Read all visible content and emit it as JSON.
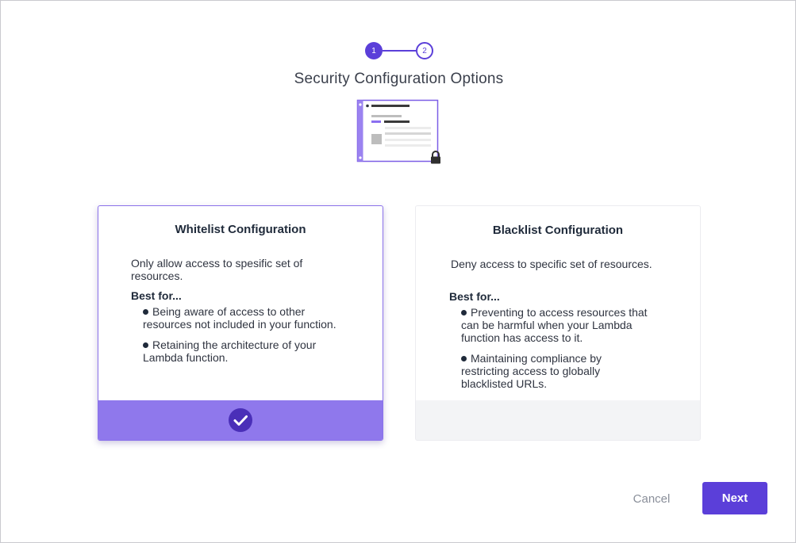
{
  "stepper": {
    "steps": [
      "1",
      "2"
    ],
    "active_step": 1,
    "accent_color": "#5b3fd9"
  },
  "title": "Security Configuration Options",
  "illustration": {
    "name": "function-config-lock-illustration",
    "icons": [
      "lock-icon"
    ]
  },
  "cards": [
    {
      "id": "whitelist",
      "title": "Whitelist Configuration",
      "description": "Only allow access to spesific set of resources.",
      "best_for_label": "Best for...",
      "bullets": [
        "Being aware of access to other resources not included in your function.",
        "Retaining the architecture of your Lambda function."
      ],
      "selected": true,
      "footer_icon": "check-circle-icon",
      "footer_color": "#8f78ec"
    },
    {
      "id": "blacklist",
      "title": "Blacklist Configuration",
      "description": "Deny access to specific set of resources.",
      "best_for_label": "Best for...",
      "bullets": [
        "Preventing to access resources that can be harmful when your Lambda function has access to it.",
        "Maintaining compliance by restricting access to globally blacklisted URLs."
      ],
      "selected": false,
      "footer_color": "#f3f4f6"
    }
  ],
  "actions": {
    "cancel_label": "Cancel",
    "next_label": "Next"
  }
}
